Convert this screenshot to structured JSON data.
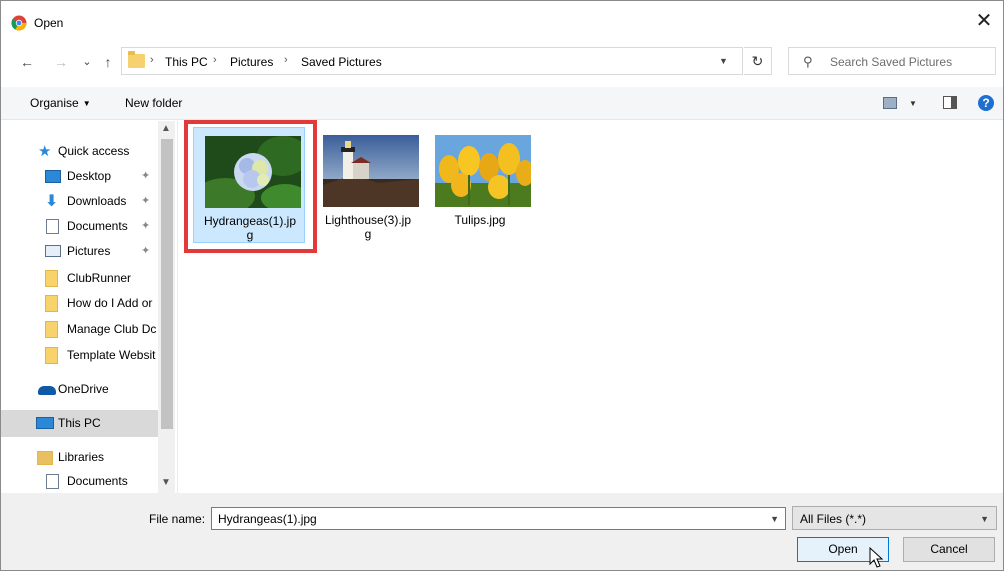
{
  "window": {
    "title": "Open",
    "close_glyph": "✕"
  },
  "nav": {
    "back": "←",
    "forward": "→",
    "recent": "⌄",
    "up": "↑",
    "breadcrumb": [
      "This PC",
      "Pictures",
      "Saved Pictures"
    ],
    "refresh": "↻",
    "search_placeholder": "Search Saved Pictures"
  },
  "toolbar": {
    "organise_label": "Organise",
    "new_folder_label": "New folder",
    "help": "?"
  },
  "sidebar": {
    "items": [
      {
        "label": "Quick access",
        "icon": "star-icon",
        "pinned": false
      },
      {
        "label": "Desktop",
        "icon": "desktop-icon",
        "pinned": true
      },
      {
        "label": "Downloads",
        "icon": "download-arrow-icon",
        "pinned": true
      },
      {
        "label": "Documents",
        "icon": "document-icon",
        "pinned": true
      },
      {
        "label": "Pictures",
        "icon": "pictures-icon",
        "pinned": true
      },
      {
        "label": "ClubRunner",
        "icon": "folder-icon",
        "pinned": false
      },
      {
        "label": "How do I Add or",
        "icon": "folder-icon",
        "pinned": false
      },
      {
        "label": "Manage Club Dc",
        "icon": "folder-icon",
        "pinned": false
      },
      {
        "label": "Template Websit",
        "icon": "folder-icon",
        "pinned": false
      },
      {
        "label": "OneDrive",
        "icon": "cloud-icon",
        "pinned": false
      },
      {
        "label": "This PC",
        "icon": "computer-icon",
        "pinned": false,
        "selected": true
      },
      {
        "label": "Libraries",
        "icon": "libraries-icon",
        "pinned": false
      },
      {
        "label": "Documents",
        "icon": "document-icon",
        "pinned": false
      }
    ],
    "pin_glyph": "✦"
  },
  "files": [
    {
      "name": "Hydrangeas(1).jpg",
      "label_line1": "Hydrangeas(1).jp",
      "label_line2": "g",
      "selected": true
    },
    {
      "name": "Lighthouse(3).jpg",
      "label_line1": "Lighthouse(3).jp",
      "label_line2": "g",
      "selected": false
    },
    {
      "name": "Tulips.jpg",
      "label_line1": "Tulips.jpg",
      "label_line2": "",
      "selected": false
    }
  ],
  "bottom": {
    "file_name_label": "File name:",
    "file_name_value": "Hydrangeas(1).jpg",
    "filter_value": "All Files (*.*)",
    "open_label": "Open",
    "cancel_label": "Cancel"
  },
  "colors": {
    "accent": "#0078d7",
    "selection": "#cce8ff",
    "highlight": "#e23a3a"
  }
}
